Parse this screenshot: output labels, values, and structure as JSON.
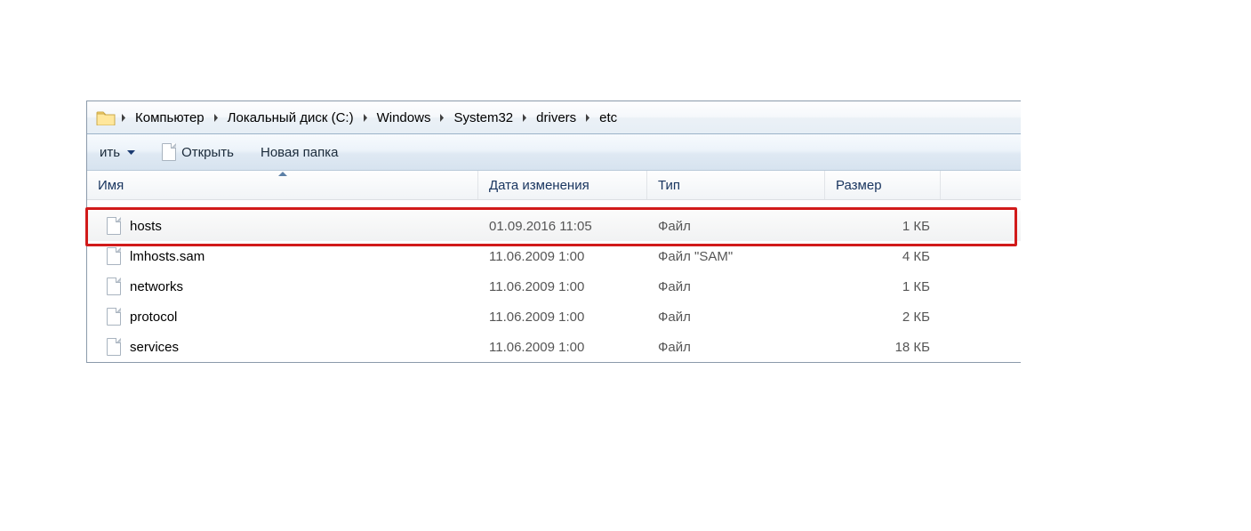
{
  "breadcrumb": [
    "Компьютер",
    "Локальный диск (C:)",
    "Windows",
    "System32",
    "drivers",
    "etc"
  ],
  "toolbar": {
    "share_partial": "ить",
    "open": "Открыть",
    "new_folder": "Новая папка"
  },
  "columns": {
    "name": "Имя",
    "date": "Дата изменения",
    "type": "Тип",
    "size": "Размер"
  },
  "files": [
    {
      "name": "hosts",
      "date": "01.09.2016 11:05",
      "type": "Файл",
      "size": "1 КБ",
      "selected": true,
      "highlighted": true
    },
    {
      "name": "lmhosts.sam",
      "date": "11.06.2009 1:00",
      "type": "Файл \"SAM\"",
      "size": "4 КБ"
    },
    {
      "name": "networks",
      "date": "11.06.2009 1:00",
      "type": "Файл",
      "size": "1 КБ"
    },
    {
      "name": "protocol",
      "date": "11.06.2009 1:00",
      "type": "Файл",
      "size": "2 КБ"
    },
    {
      "name": "services",
      "date": "11.06.2009 1:00",
      "type": "Файл",
      "size": "18 КБ"
    }
  ]
}
